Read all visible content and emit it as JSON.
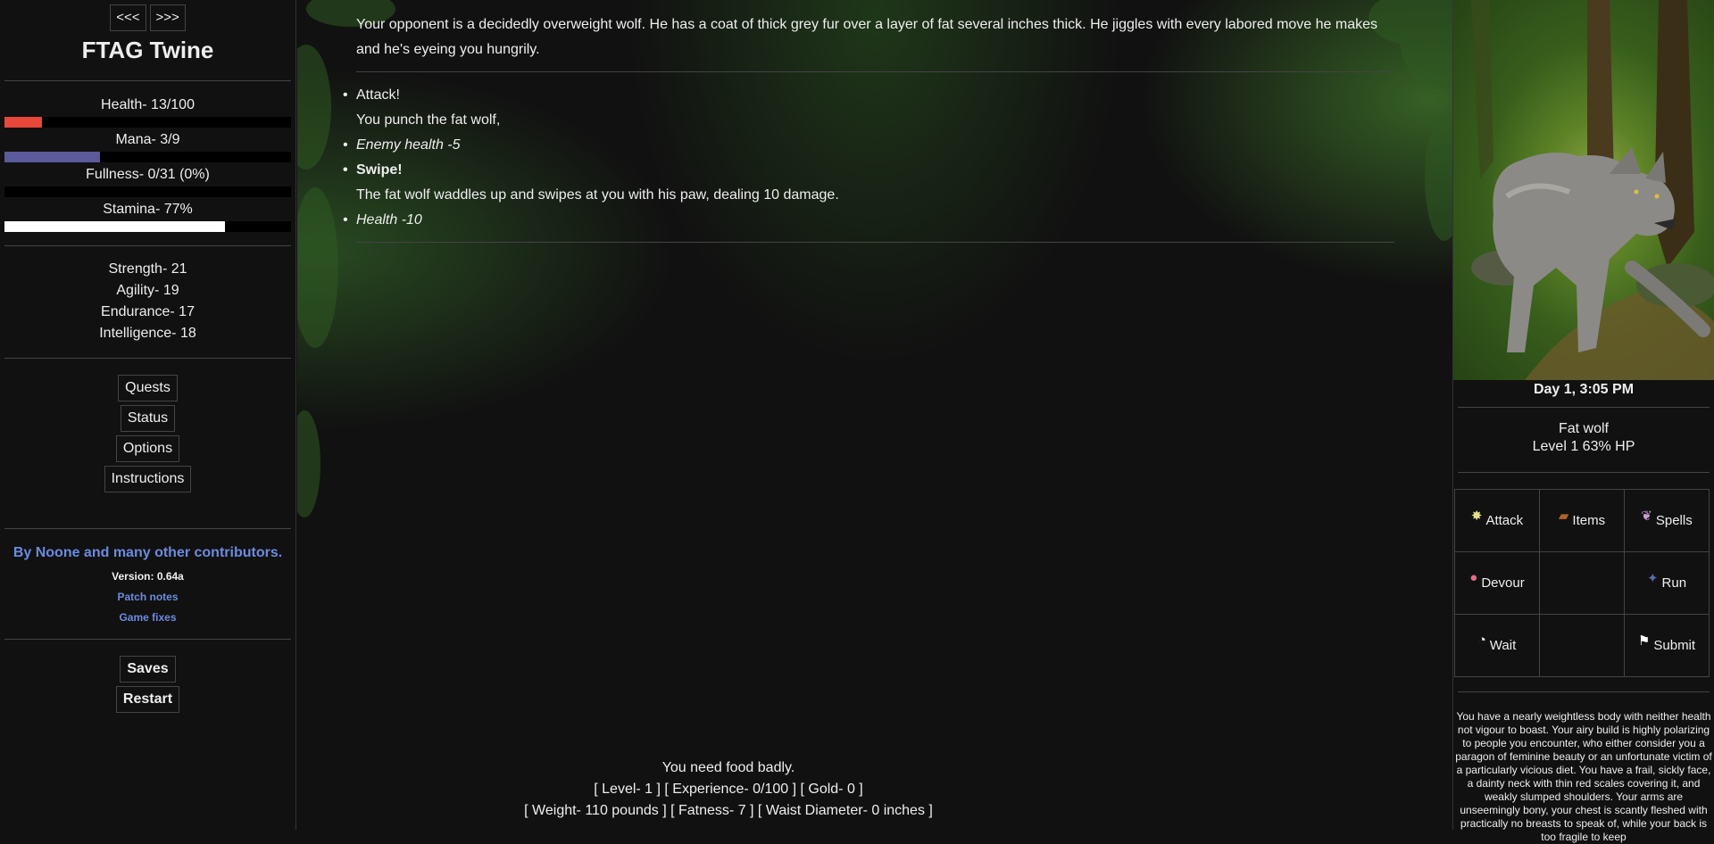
{
  "sidebar": {
    "history_back": "<<<",
    "history_forward": ">>>",
    "title": "FTAG Twine",
    "stats": {
      "health_label": "Health- 13/100",
      "health_fraction": 0.13,
      "health_color": "#e8473b",
      "mana_label": "Mana- 3/9",
      "mana_fraction": 0.333,
      "mana_color": "#5a5a9c",
      "fullness_label": "Fullness- 0/31 (0%)",
      "fullness_fraction": 0.0,
      "stamina_label": "Stamina- 77%",
      "stamina_fraction": 0.77,
      "stamina_color": "#ffffff"
    },
    "attributes": {
      "strength": "Strength- 21",
      "agility": "Agility- 19",
      "endurance": "Endurance- 17",
      "intelligence": "Intelligence- 18"
    },
    "menu": {
      "quests": "Quests",
      "status": "Status",
      "options": "Options",
      "instructions": "Instructions"
    },
    "credits": "By Noone and many other contributors.",
    "version": "Version: 0.64a",
    "patch_notes": "Patch notes",
    "game_fixes": "Game fixes",
    "saves": "Saves",
    "restart": "Restart"
  },
  "passage": {
    "intro": "Your opponent is a decidedly overweight wolf. He has a coat of thick grey fur over a layer of fat several inches thick. He jiggles with every labored move he makes and he's eyeing you hungrily.",
    "log": {
      "player_action": "Attack!",
      "player_text": "You punch the fat wolf,",
      "player_effect": "Enemy health -5",
      "enemy_action": "Swipe!",
      "enemy_text": "The fat wolf waddles up and swipes at you with his paw, dealing 10 damage.",
      "enemy_effect": "Health -10"
    }
  },
  "footer": {
    "hunger": "You need food badly.",
    "line1": "[ Level- 1 ] [ Experience- 0/100 ] [ Gold- 0 ]",
    "line2": "[ Weight- 110 pounds ] [ Fatness- 7 ] [ Waist Diameter- 0 inches ]"
  },
  "right": {
    "time": "Day 1, 3:05 PM",
    "enemy_name": "Fat wolf",
    "enemy_status": "Level 1 63% HP",
    "actions": {
      "attack": "Attack",
      "items": "Items",
      "spells": "Spells",
      "devour": "Devour",
      "run": "Run",
      "wait": "Wait",
      "submit": "Submit"
    },
    "description": "You have a nearly weightless body with neither health not vigour to boast. Your airy build is highly polarizing to people you encounter, who either consider you a paragon of feminine beauty or an unfortunate victim of a particularly vicious diet. You have a frail, sickly face, a dainty neck with thin red scales covering it, and weakly slumped shoulders. Your arms are unseemingly bony, your chest is scantly fleshed with practically no breasts to speak of, while your back is too fragile to keep"
  },
  "icons": {
    "attack": "attack-sparkle-icon",
    "items": "treasure-chest-icon",
    "spells": "spellbook-icon",
    "devour": "mouth-icon",
    "run": "running-figure-icon",
    "wait": "clock-icon",
    "submit": "white-flag-icon"
  }
}
